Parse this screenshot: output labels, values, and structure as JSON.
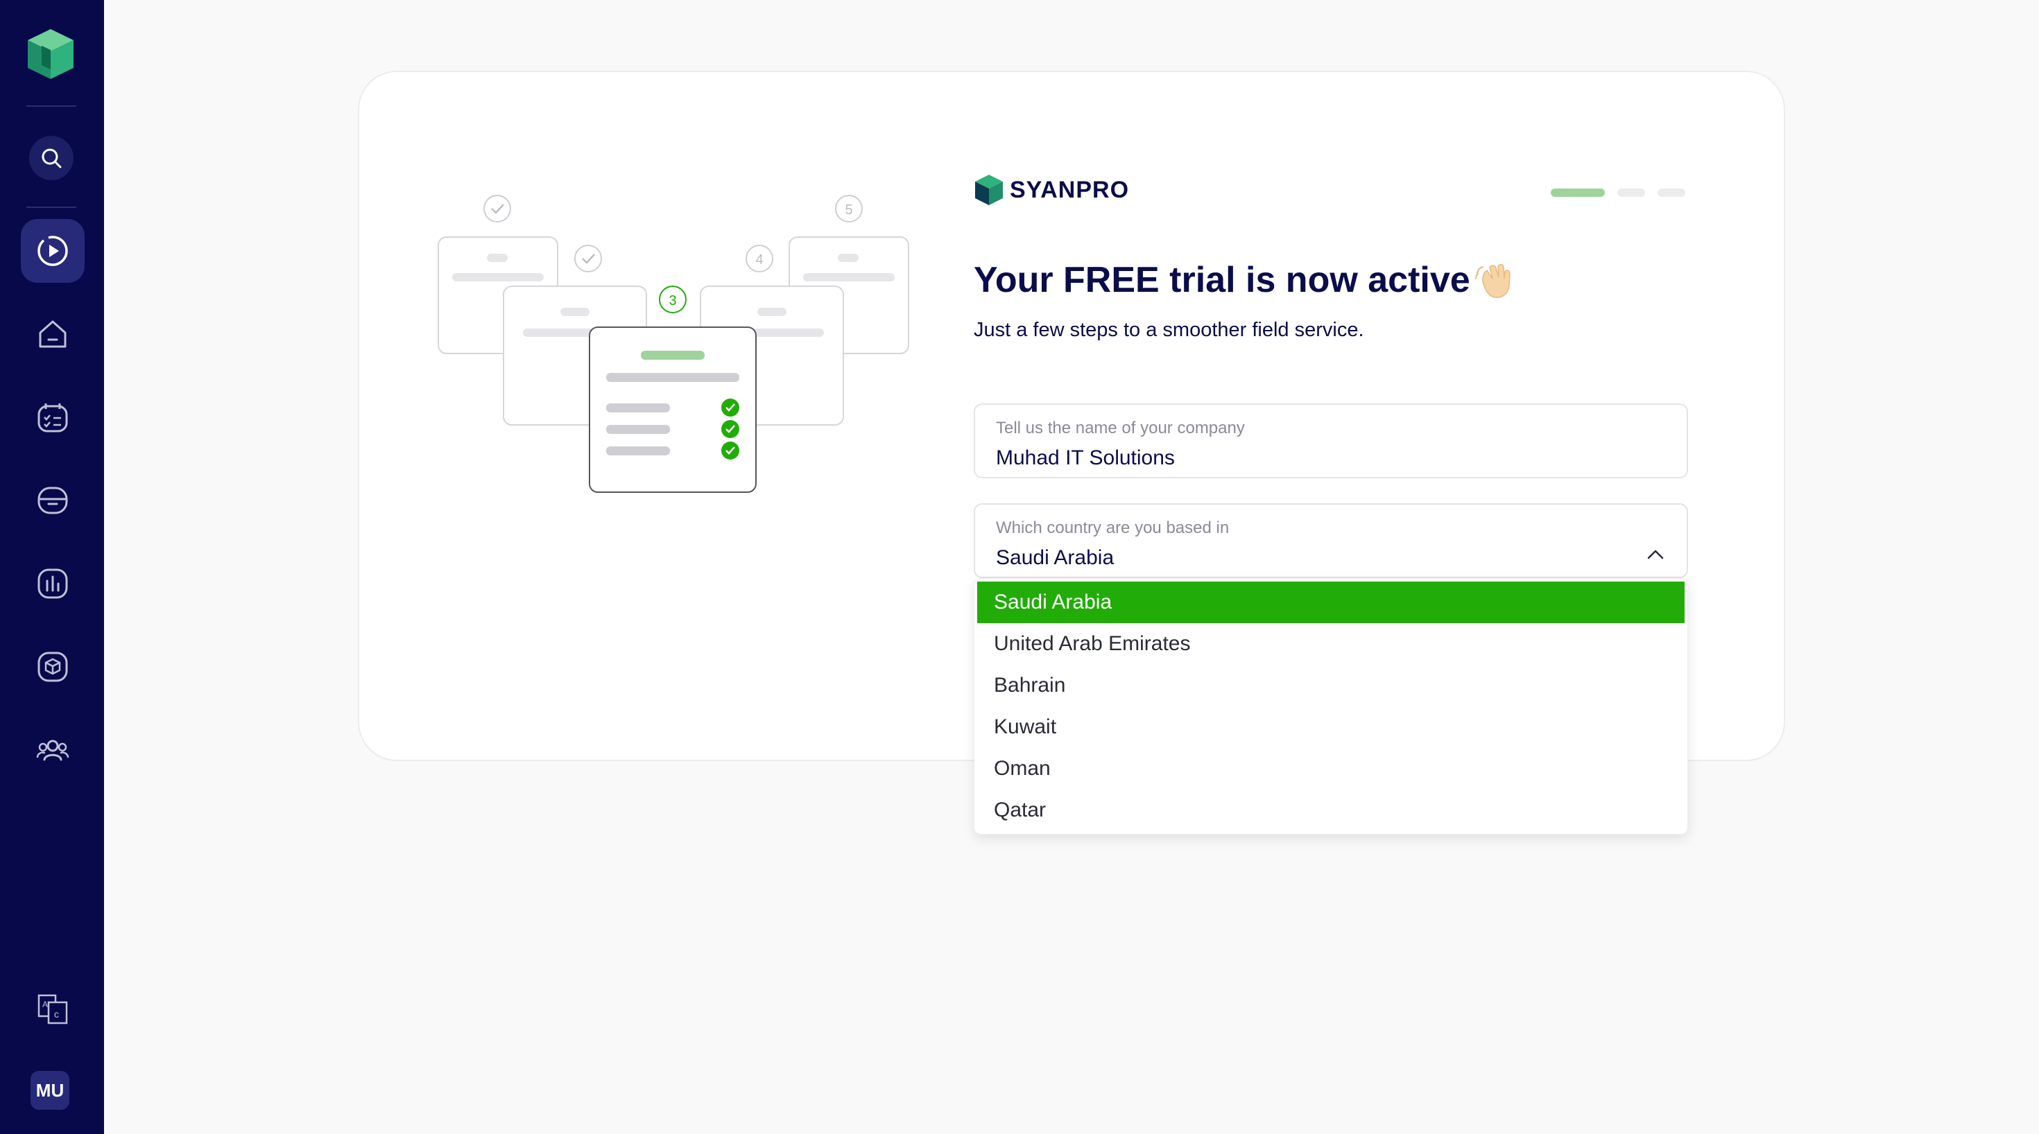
{
  "sidebar": {
    "avatar_initials": "MU",
    "nav": [
      {
        "name": "search",
        "icon": "search-icon"
      },
      {
        "name": "getting-started",
        "icon": "play-circle-icon",
        "active": true
      },
      {
        "name": "home",
        "icon": "home-icon"
      },
      {
        "name": "schedule",
        "icon": "calendar-checklist-icon"
      },
      {
        "name": "inbox",
        "icon": "inbox-icon"
      },
      {
        "name": "reports",
        "icon": "bar-chart-icon"
      },
      {
        "name": "inventory",
        "icon": "box-icon"
      },
      {
        "name": "team",
        "icon": "users-icon"
      },
      {
        "name": "language",
        "icon": "translate-icon"
      }
    ]
  },
  "brand": {
    "name": "SYANPRO"
  },
  "header": {
    "title_prefix": "Your ",
    "title_highlight": "FREE",
    "title_suffix": " trial is now active",
    "subtitle": "Just a few steps to a smoother field service."
  },
  "illustration": {
    "steps": [
      "3",
      "4",
      "5"
    ]
  },
  "company_field": {
    "label": "Tell us the name of your company",
    "value": "Muhad IT Solutions"
  },
  "country_field": {
    "label": "Which country are you based in",
    "value": "Saudi Arabia"
  },
  "country_options": [
    "Saudi Arabia",
    "United Arab Emirates",
    "Bahrain",
    "Kuwait",
    "Oman",
    "Qatar"
  ],
  "colors": {
    "sidebar": "#08094a",
    "accent": "#21ac08",
    "progress_active": "#9ed39b",
    "text_primary": "#0b0d4a"
  }
}
